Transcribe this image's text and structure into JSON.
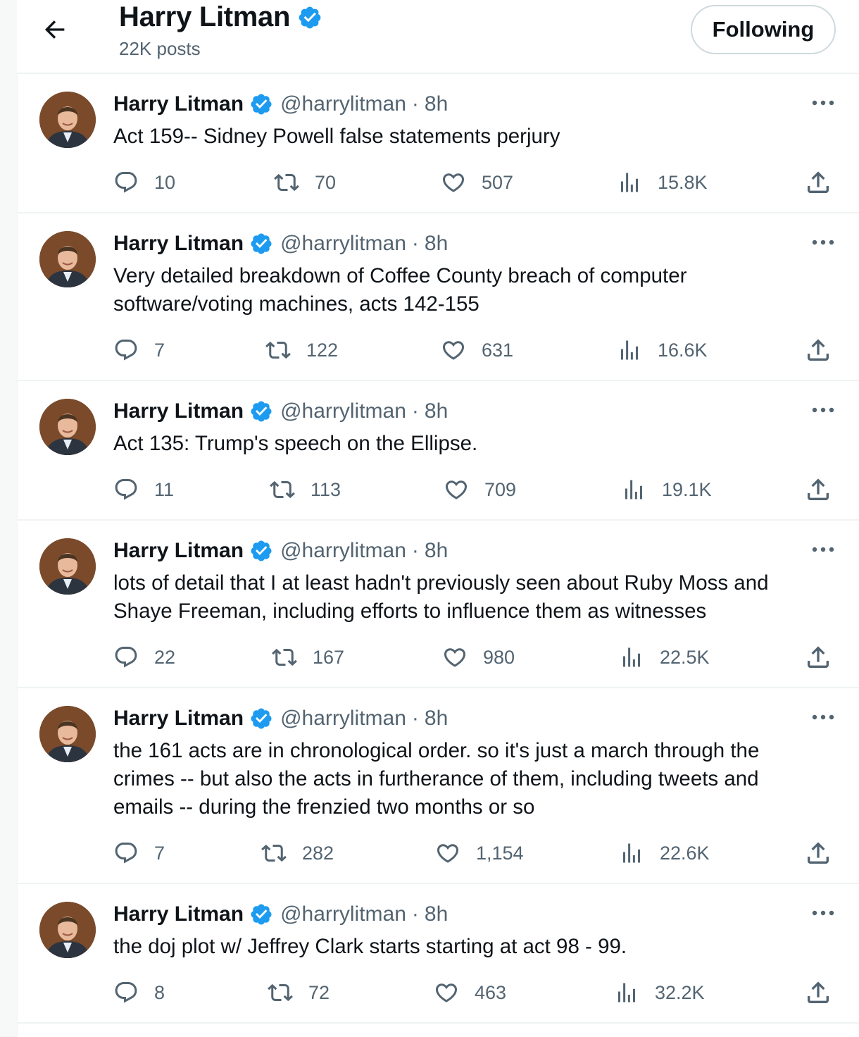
{
  "header": {
    "title": "Harry Litman",
    "posts": "22K posts",
    "follow_label": "Following"
  },
  "colors": {
    "verified": "#1d9bf0",
    "secondary_text": "#536471",
    "divider": "#eff3f4"
  },
  "icons": [
    "back-arrow-icon",
    "verified-badge-icon",
    "more-icon",
    "reply-icon",
    "repost-icon",
    "like-icon",
    "views-icon",
    "share-icon"
  ],
  "tweets": [
    {
      "name": "Harry Litman",
      "handle": "@harrylitman",
      "dot": "·",
      "time": "8h",
      "text": "Act 159-- Sidney Powell false statements perjury",
      "replies": "10",
      "reposts": "70",
      "likes": "507",
      "views": "15.8K"
    },
    {
      "name": "Harry Litman",
      "handle": "@harrylitman",
      "dot": "·",
      "time": "8h",
      "text": "Very detailed breakdown of Coffee County breach of computer software/voting machines, acts 142-155",
      "replies": "7",
      "reposts": "122",
      "likes": "631",
      "views": "16.6K"
    },
    {
      "name": "Harry Litman",
      "handle": "@harrylitman",
      "dot": "·",
      "time": "8h",
      "text": "Act 135: Trump's speech on the Ellipse.",
      "replies": "11",
      "reposts": "113",
      "likes": "709",
      "views": "19.1K"
    },
    {
      "name": "Harry Litman",
      "handle": "@harrylitman",
      "dot": "·",
      "time": "8h",
      "text": "lots of detail that I at least hadn't previously seen about Ruby Moss and Shaye Freeman, including efforts to influence them as witnesses",
      "replies": "22",
      "reposts": "167",
      "likes": "980",
      "views": "22.5K"
    },
    {
      "name": "Harry Litman",
      "handle": "@harrylitman",
      "dot": "·",
      "time": "8h",
      "text": "the 161 acts are in chronological order.  so it's just a march through the crimes -- but also the acts in furtherance of them, including tweets and emails -- during the frenzied two months or so",
      "replies": "7",
      "reposts": "282",
      "likes": "1,154",
      "views": "22.6K"
    },
    {
      "name": "Harry Litman",
      "handle": "@harrylitman",
      "dot": "·",
      "time": "8h",
      "text": "the  doj plot w/ Jeffrey Clark starts starting at act 98 - 99.",
      "replies": "8",
      "reposts": "72",
      "likes": "463",
      "views": "32.2K"
    }
  ]
}
